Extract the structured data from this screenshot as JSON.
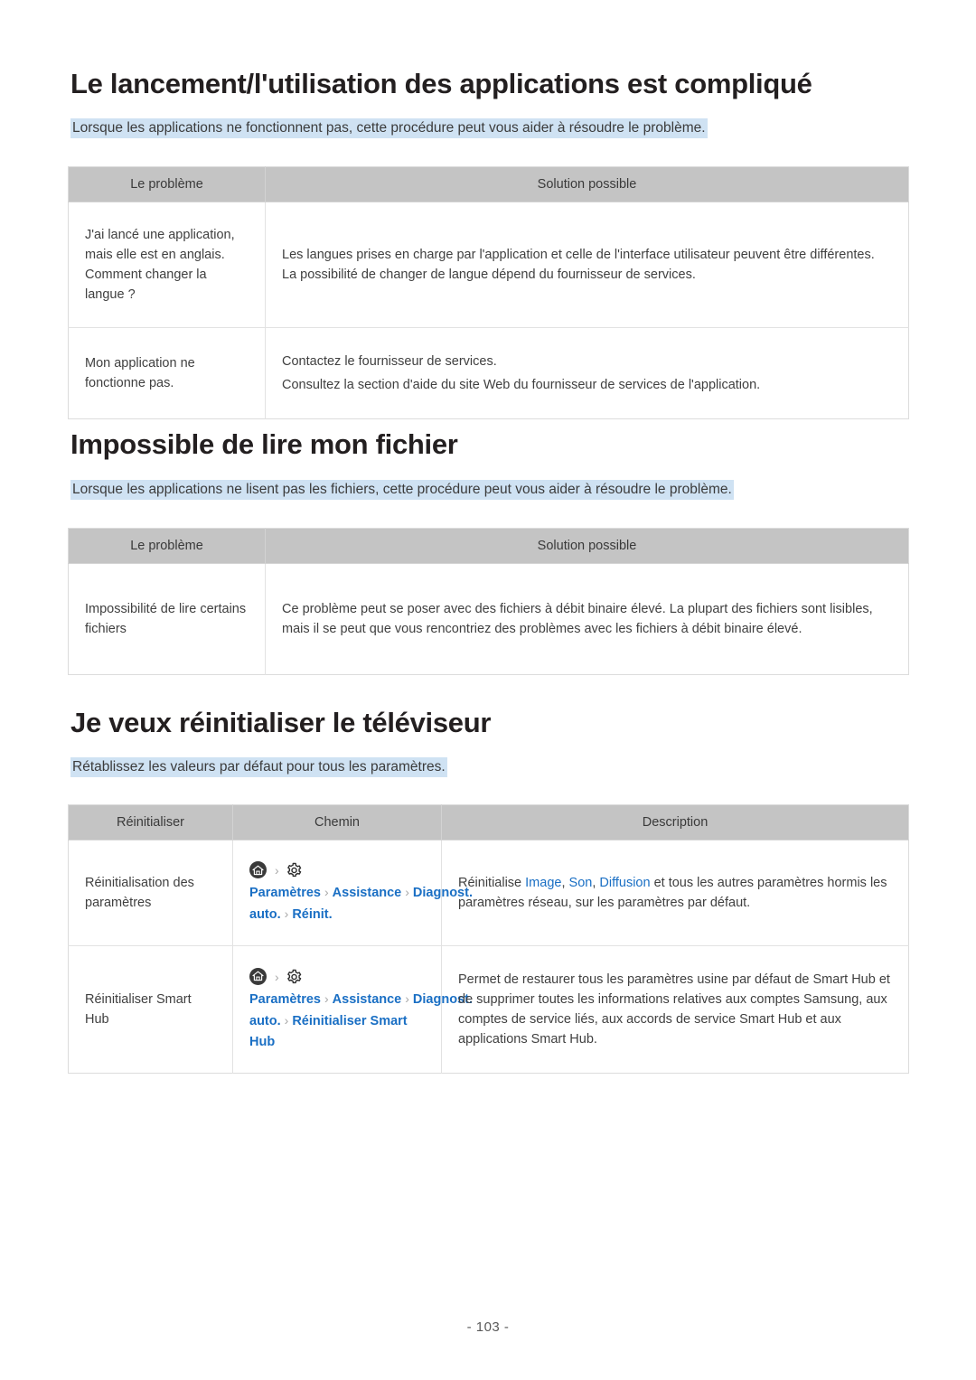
{
  "page": {
    "number_label": "- 103 -"
  },
  "sections": [
    {
      "title": "Le lancement/l'utilisation des applications est compliqué",
      "intro": "Lorsque les applications ne fonctionnent pas, cette procédure peut vous aider à résoudre le problème.",
      "table": {
        "headers": [
          "Le problème",
          "Solution possible"
        ],
        "rows": [
          {
            "problem": "J'ai lancé une application, mais elle est en anglais. Comment changer la langue ?",
            "solution": "Les langues prises en charge par l'application et celle de l'interface utilisateur peuvent être différentes. La possibilité de changer de langue dépend du fournisseur de services."
          },
          {
            "problem": "Mon application ne fonctionne pas.",
            "solution_line1": "Contactez le fournisseur de services.",
            "solution_line2": "Consultez la section d'aide du site Web du fournisseur de services de l'application."
          }
        ]
      }
    },
    {
      "title": "Impossible de lire mon fichier",
      "intro": "Lorsque les applications ne lisent pas les fichiers, cette procédure peut vous aider à résoudre le problème.",
      "table": {
        "headers": [
          "Le problème",
          "Solution possible"
        ],
        "rows": [
          {
            "problem": "Impossibilité de lire certains fichiers",
            "solution": "Ce problème peut se poser avec des fichiers à débit binaire élevé. La plupart des fichiers sont lisibles, mais il se peut que vous rencontriez des problèmes avec les fichiers à débit binaire élevé."
          }
        ]
      }
    },
    {
      "title": "Je veux réinitialiser le téléviseur",
      "intro": "Rétablissez les valeurs par défaut pour tous les paramètres.",
      "table": {
        "headers": [
          "Réinitialiser",
          "Chemin",
          "Description"
        ],
        "rows": [
          {
            "reset": "Réinitialisation des paramètres",
            "path": {
              "home_icon": "home-icon",
              "gear_icon": "gear-icon",
              "steps": [
                "Paramètres",
                "Assistance",
                "Diagnost. auto.",
                "Réinit."
              ],
              "separator": "›"
            },
            "description_prefix": "Réinitialise ",
            "description_links": [
              "Image",
              "Son",
              "Diffusion"
            ],
            "description_suffix": " et tous les autres paramètres hormis les paramètres réseau, sur les paramètres par défaut."
          },
          {
            "reset": "Réinitialiser Smart Hub",
            "path": {
              "home_icon": "home-icon",
              "gear_icon": "gear-icon",
              "steps": [
                "Paramètres",
                "Assistance",
                "Diagnost. auto.",
                "Réinitialiser Smart Hub"
              ],
              "separator": "›"
            },
            "description": "Permet de restaurer tous les paramètres usine par défaut de Smart Hub et de supprimer toutes les informations relatives aux comptes Samsung, aux comptes de service liés, aux accords de service Smart Hub et aux applications Smart Hub."
          }
        ]
      }
    }
  ],
  "colors": {
    "heading": "#231f20",
    "highlight": "#cfe2f3",
    "link": "#1a6fc4",
    "table_header_bg": "#c4c4c4"
  }
}
